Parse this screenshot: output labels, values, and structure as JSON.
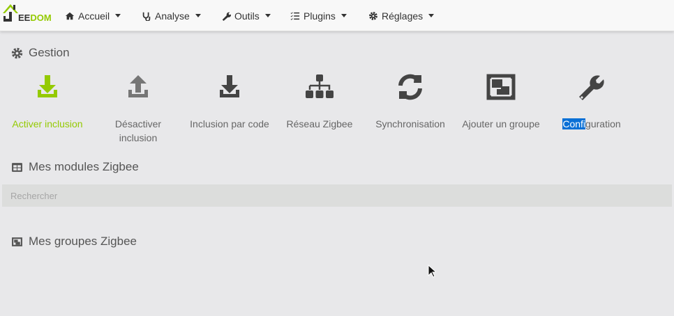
{
  "brand": {
    "logo_text_1": "EE",
    "logo_text_2": "DOM",
    "logo_j": "J"
  },
  "nav": [
    {
      "label": "Accueil",
      "icon": "home-icon"
    },
    {
      "label": "Analyse",
      "icon": "stethoscope-icon"
    },
    {
      "label": "Outils",
      "icon": "wrench-icon"
    },
    {
      "label": "Plugins",
      "icon": "tasks-icon"
    },
    {
      "label": "Réglages",
      "icon": "cog-icon"
    }
  ],
  "gestion": {
    "title": "Gestion",
    "actions": [
      {
        "label": "Activer inclusion",
        "icon": "download-icon",
        "color": "#94ca02"
      },
      {
        "label": "Désactiver",
        "label2": "inclusion",
        "icon": "upload-icon",
        "color": "#767676"
      },
      {
        "label": "Inclusion par code",
        "icon": "download-icon",
        "color": "#444"
      },
      {
        "label": "Réseau Zigbee",
        "icon": "sitemap-icon",
        "color": "#444"
      },
      {
        "label": "Synchronisation",
        "icon": "sync-icon",
        "color": "#444"
      },
      {
        "label": "Ajouter un groupe",
        "icon": "object-group-icon",
        "color": "#444"
      },
      {
        "label_selected": "Confi",
        "label_rest": "guration",
        "icon": "wrench-icon",
        "color": "#444"
      }
    ]
  },
  "modules": {
    "title": "Mes modules Zigbee",
    "search_placeholder": "Rechercher"
  },
  "groups": {
    "title": "Mes groupes Zigbee"
  },
  "colors": {
    "accent": "#94ca02",
    "selection": "#0a70d6"
  }
}
